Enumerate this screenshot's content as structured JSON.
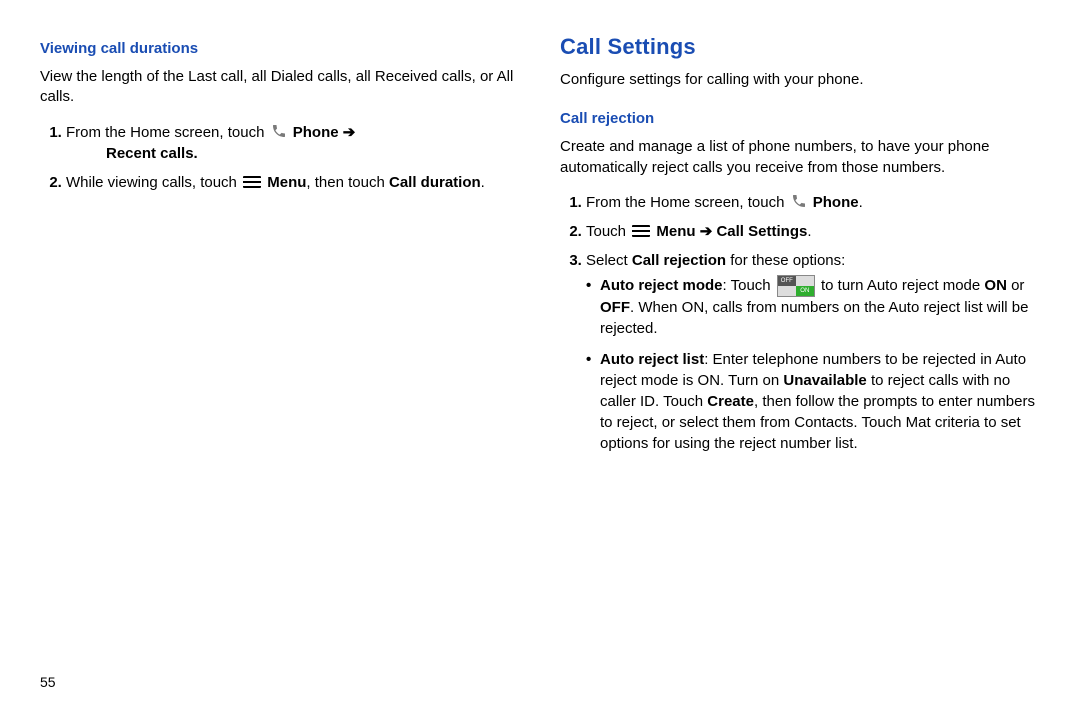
{
  "left": {
    "heading": "Viewing call durations",
    "intro": "View the length of the Last call, all Dialed calls, all Received calls, or All calls.",
    "step1_a": "From the Home screen, touch ",
    "step1_b": "Phone",
    "arrow": "➔",
    "step1_c": "Recent calls",
    "step2_a": "While viewing calls, touch ",
    "step2_b": "Menu",
    "step2_c": ", then touch ",
    "step2_d": "Call duration",
    "step2_e": "."
  },
  "right": {
    "main_heading": "Call Settings",
    "intro": "Configure settings for calling with your phone.",
    "sub_heading": "Call rejection",
    "sub_intro": "Create and manage a list of phone numbers, to have your phone automatically reject calls you receive from those numbers.",
    "r1_a": "From the Home screen, touch ",
    "r1_b": "Phone",
    "r1_c": ".",
    "r2_a": "Touch ",
    "r2_b": "Menu",
    "r2_c": "Call Settings",
    "r2_d": ".",
    "r3_a": "Select ",
    "r3_b": "Call rejection",
    "r3_c": " for these options:",
    "b1_a": "Auto reject mode",
    "b1_b": ": Touch ",
    "b1_c": " to turn Auto reject mode ",
    "b1_d": "ON",
    "b1_e": " or ",
    "b1_f": "OFF",
    "b1_g": ". When ON, calls from numbers on the Auto reject list will be rejected.",
    "b2_a": "Auto reject list",
    "b2_b": ": Enter telephone numbers to be rejected in Auto reject mode is ON. Turn on ",
    "b2_c": "Unavailable",
    "b2_d": " to reject calls with no caller ID. Touch ",
    "b2_e": "Create",
    "b2_f": ", then follow the prompts to enter numbers to reject, or select them from Contacts. Touch Mat criteria to set options for using the reject number list."
  },
  "toggle": {
    "off": "OFF",
    "on": "ON"
  },
  "page_number": "55"
}
